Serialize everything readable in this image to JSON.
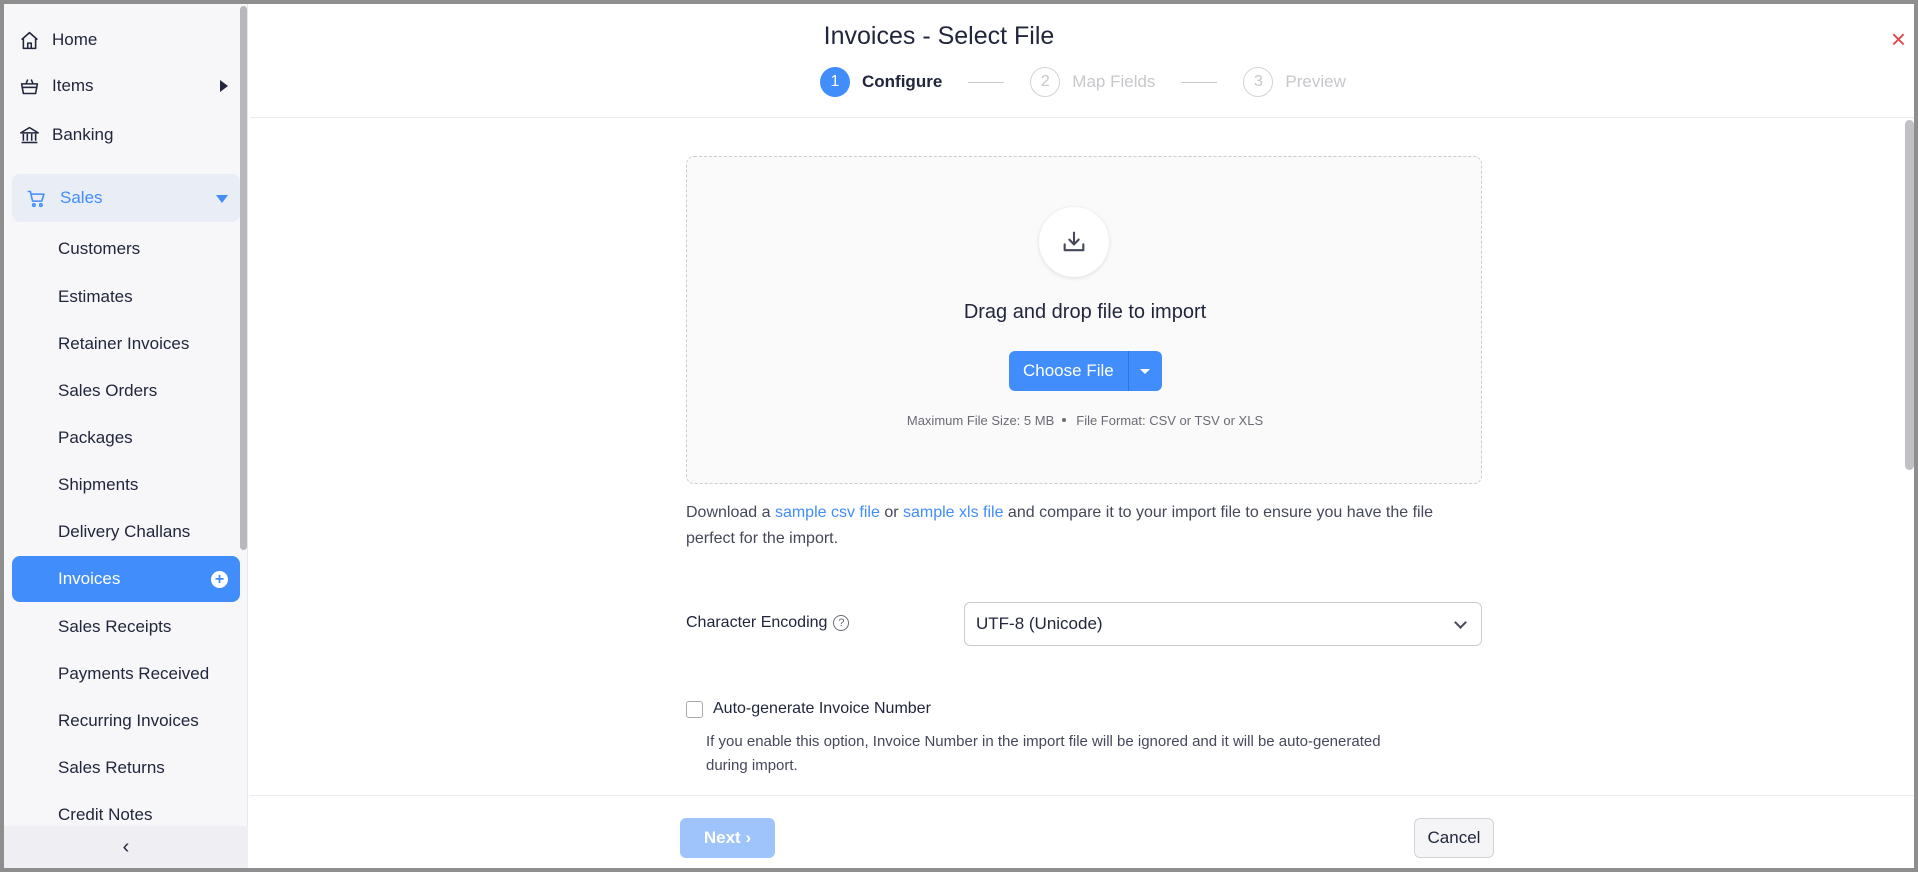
{
  "sidebar": {
    "top_items": [
      {
        "label": "Home",
        "icon": "home-icon"
      },
      {
        "label": "Items",
        "icon": "basket-icon"
      },
      {
        "label": "Banking",
        "icon": "bank-icon"
      }
    ],
    "sales": {
      "label": "Sales",
      "icon": "cart-icon"
    },
    "sales_items": [
      {
        "label": "Customers"
      },
      {
        "label": "Estimates"
      },
      {
        "label": "Retainer Invoices"
      },
      {
        "label": "Sales Orders"
      },
      {
        "label": "Packages"
      },
      {
        "label": "Shipments"
      },
      {
        "label": "Delivery Challans"
      },
      {
        "label": "Invoices",
        "active": true
      },
      {
        "label": "Sales Receipts"
      },
      {
        "label": "Payments Received"
      },
      {
        "label": "Recurring Invoices"
      },
      {
        "label": "Sales Returns"
      },
      {
        "label": "Credit Notes"
      }
    ],
    "collapse_glyph": "‹"
  },
  "header": {
    "title": "Invoices - Select File",
    "close_glyph": "×",
    "steps": [
      {
        "num": "1",
        "label": "Configure",
        "state": "active"
      },
      {
        "num": "2",
        "label": "Map Fields",
        "state": "inactive"
      },
      {
        "num": "3",
        "label": "Preview",
        "state": "inactive"
      }
    ]
  },
  "upload": {
    "drag_text": "Drag and drop file to import",
    "choose_label": "Choose File",
    "max_size": "Maximum File Size: 5 MB",
    "format": "File Format: CSV or TSV or XLS"
  },
  "download": {
    "prefix": "Download a ",
    "csv_link": "sample csv file",
    "middle": " or ",
    "xls_link": "sample xls file",
    "suffix": " and compare it to your import file to ensure you have the file perfect for the import."
  },
  "encoding": {
    "label": "Character Encoding",
    "help_glyph": "?",
    "value": "UTF-8 (Unicode)"
  },
  "auto_generate": {
    "label": "Auto-generate Invoice Number",
    "checked": false,
    "description": "If you enable this option, Invoice Number in the import file will be ignored and it will be auto-generated during import."
  },
  "footer": {
    "next_label": "Next",
    "next_glyph": "›",
    "cancel_label": "Cancel"
  },
  "colors": {
    "accent": "#408dfb",
    "close": "#e0474c",
    "next_disabled": "#9ec4fb"
  }
}
